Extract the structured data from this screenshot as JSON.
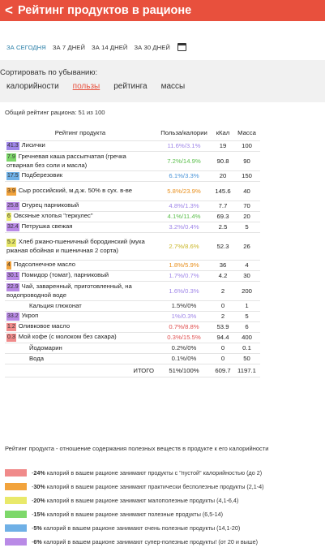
{
  "header": {
    "back_label": "<",
    "title": "Рейтинг продуктов в рационе"
  },
  "tabs": [
    {
      "label": "ЗА СЕГОДНЯ",
      "active": true
    },
    {
      "label": "ЗА 7 ДНЕЙ",
      "active": false
    },
    {
      "label": "ЗА 14 ДНЕЙ",
      "active": false
    },
    {
      "label": "ЗА 30 ДНЕЙ",
      "active": false
    }
  ],
  "calendar_icon": "calendar-icon",
  "sort": {
    "title": "Сортировать по убыванию:",
    "options": [
      {
        "label": "калорийности",
        "active": false
      },
      {
        "label": "пользы",
        "active": true
      },
      {
        "label": "рейтинга",
        "active": false
      },
      {
        "label": "массы",
        "active": false
      }
    ]
  },
  "overall_text": "Общий рейтинг рациона: 51 из 100",
  "table": {
    "headers": {
      "product": "Рейтинг продукта",
      "ratio": "Польза/калории",
      "kcal": "кКал",
      "mass": "Масса"
    },
    "rows": [
      {
        "score": "41.3",
        "name": "Лисички",
        "ratio": "11.6%/3.1%",
        "kcal": "19",
        "mass": "100",
        "color": "#9f86e8",
        "ratio_color": "#9f86e8"
      },
      {
        "score": "7.9",
        "name": "Гречневая каша рассыпчатая (гречка отварная без соли и масла)",
        "ratio": "7.2%/14.9%",
        "kcal": "90.8",
        "mass": "90",
        "color": "#7dd86a",
        "ratio_color": "#5bbf4c"
      },
      {
        "score": "17.5",
        "name": "Подберезовик",
        "ratio": "6.1%/3.3%",
        "kcal": "20",
        "mass": "150",
        "color": "#6fb0e6",
        "ratio_color": "#4a94d8"
      },
      {
        "score": "3.9",
        "name": "Сыр российский, м.д.ж. 50% в сух. в-ве",
        "ratio": "5.8%/23.9%",
        "kcal": "145.6",
        "mass": "40",
        "color": "#f2a33c",
        "ratio_color": "#e88f1c"
      },
      {
        "score": "25.8",
        "name": "Огурец парниковый",
        "ratio": "4.8%/1.3%",
        "kcal": "7.7",
        "mass": "70",
        "color": "#b98ae6",
        "ratio_color": "#9f86e8"
      },
      {
        "score": "6",
        "name": "Овсяные хлопья \"геркулес\"",
        "ratio": "4.1%/11.4%",
        "kcal": "69.3",
        "mass": "20",
        "color": "#e9e96a",
        "ratio_color": "#5bbf4c"
      },
      {
        "score": "32.4",
        "name": "Петрушка свежая",
        "ratio": "3.2%/0.4%",
        "kcal": "2.5",
        "mass": "5",
        "color": "#b98ae6",
        "ratio_color": "#9f86e8"
      },
      {
        "score": "5.2",
        "name": "Хлеб ржано-пшеничный бородинский (мука ржаная обойная и пшеничная 2 сорта)",
        "ratio": "2.7%/8.6%",
        "kcal": "52.3",
        "mass": "26",
        "color": "#e9e96a",
        "ratio_color": "#c9b628"
      },
      {
        "score": "4",
        "name": "Подсолнечное масло",
        "ratio": "1.8%/5.9%",
        "kcal": "36",
        "mass": "4",
        "color": "#f2a33c",
        "ratio_color": "#e88f1c"
      },
      {
        "score": "30.1",
        "name": "Помидор (томат), парниковый",
        "ratio": "1.7%/0.7%",
        "kcal": "4.2",
        "mass": "30",
        "color": "#b98ae6",
        "ratio_color": "#9f86e8"
      },
      {
        "score": "22.9",
        "name": "Чай, заваренный, приготовленный, на водопроводной воде",
        "ratio": "1.6%/0.3%",
        "kcal": "2",
        "mass": "200",
        "color": "#b98ae6",
        "ratio_color": "#9f86e8"
      },
      {
        "score": "",
        "name": "Кальция глюконат",
        "ratio": "1.5%/0%",
        "kcal": "0",
        "mass": "1",
        "color": "",
        "ratio_color": "#333333"
      },
      {
        "score": "33.2",
        "name": "Укроп",
        "ratio": "1%/0.3%",
        "kcal": "2",
        "mass": "5",
        "color": "#b98ae6",
        "ratio_color": "#9f86e8"
      },
      {
        "score": "1.2",
        "name": "Оливковое масло",
        "ratio": "0.7%/8.8%",
        "kcal": "53.9",
        "mass": "6",
        "color": "#f08a8a",
        "ratio_color": "#e05050"
      },
      {
        "score": "0.3",
        "name": "Мой кофе (с молоком без сахара)",
        "ratio": "0.3%/15.5%",
        "kcal": "94.4",
        "mass": "400",
        "color": "#f08a8a",
        "ratio_color": "#e05050"
      },
      {
        "score": "",
        "name": "Йодомарин",
        "ratio": "0.2%/0%",
        "kcal": "0",
        "mass": "0.1",
        "color": "",
        "ratio_color": "#333333"
      },
      {
        "score": "",
        "name": "Вода",
        "ratio": "0.1%/0%",
        "kcal": "0",
        "mass": "50",
        "color": "",
        "ratio_color": "#333333"
      }
    ],
    "total": {
      "label": "ИТОГО",
      "ratio": "51%/100%",
      "kcal": "609.7",
      "mass": "1197.1"
    }
  },
  "explain_text": "Рейтинг продукта - отношение содержания полезных веществ в продукте к его калорийности",
  "legend": [
    {
      "color": "#f08a8a",
      "pct": "24%",
      "text": "калорий в вашем рационе занимают продукты с \"пустой\" калорийностью (до 2)"
    },
    {
      "color": "#f2a33c",
      "pct": "30%",
      "text": "калорий в вашем рационе занимают практически бесполезные продукты (2,1-4)"
    },
    {
      "color": "#e9e96a",
      "pct": "20%",
      "text": "калорий в вашем рационе занимают малополезные продукты (4,1-6,4)"
    },
    {
      "color": "#7dd86a",
      "pct": "15%",
      "text": "калорий в вашем рационе занимают полезные продукты (6,5-14)"
    },
    {
      "color": "#6fb0e6",
      "pct": "5%",
      "text": "калорий в вашем рационе занимают очень полезные продукты (14,1-20)"
    },
    {
      "color": "#b98ae6",
      "pct": "6%",
      "text": "калорий в вашем рационе занимают супер-полезные продукты! (от 20 и выше)"
    }
  ]
}
